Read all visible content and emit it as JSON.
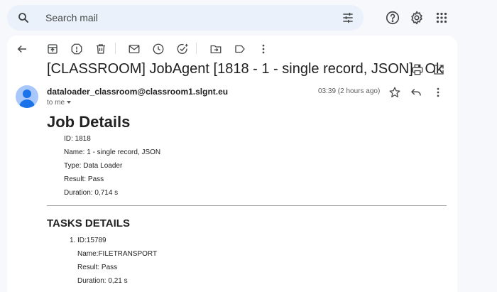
{
  "search": {
    "placeholder": "Search mail"
  },
  "email": {
    "subject": "[CLASSROOM] JobAgent [1818 - 1 - single record, JSON] : Ok",
    "sender": "dataloader_classroom@classroom1.slgnt.eu",
    "to": "to me",
    "time": "03:39 (2 hours ago)"
  },
  "job": {
    "title": "Job Details",
    "id": "ID: 1818",
    "name": "Name: 1 - single record, JSON",
    "type": "Type: Data Loader",
    "result": "Result: Pass",
    "duration": "Duration: 0,714 s"
  },
  "tasks": {
    "title": "TASKS DETAILS",
    "items": [
      {
        "number": "1.",
        "id": "ID:15789",
        "name": "Name:FILETRANSPORT",
        "result": "Result: Pass",
        "duration": "Duration: 0,21 s"
      }
    ]
  },
  "icons": {
    "header": [
      "search-icon",
      "filter-options-icon",
      "help-icon",
      "settings-icon",
      "apps-icon"
    ],
    "toolbar": [
      "back-icon",
      "archive-icon",
      "report-spam-icon",
      "delete-icon",
      "mark-unread-icon",
      "snooze-icon",
      "add-to-tasks-icon",
      "move-to-icon",
      "label-icon",
      "more-vert-icon"
    ],
    "message": [
      "print-icon",
      "open-in-new-window-icon",
      "star-icon",
      "reply-icon",
      "more-vert-icon"
    ]
  }
}
